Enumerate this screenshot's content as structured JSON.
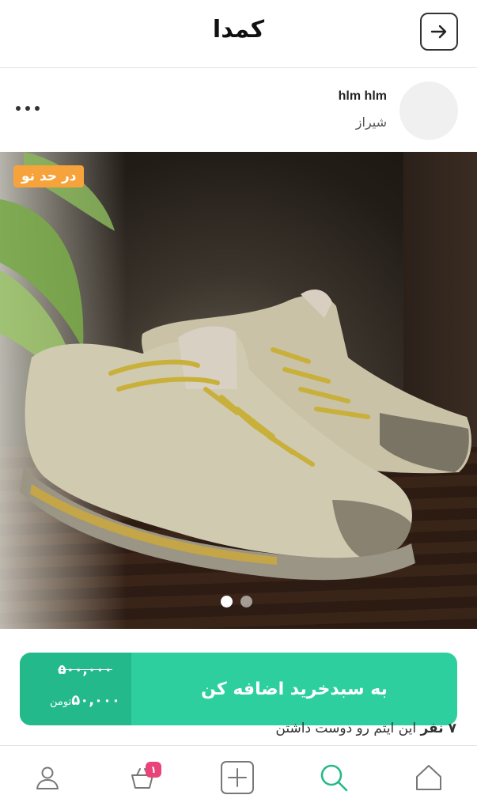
{
  "header": {
    "brand": "کمدا",
    "back_icon": "arrow-right-icon"
  },
  "seller": {
    "name": "hlm hlm",
    "city": "شیراز",
    "more_icon": "more-horizontal-icon"
  },
  "photo": {
    "condition_badge": "در حد نو",
    "carousel_count": 2,
    "carousel_active_index": 0
  },
  "cart": {
    "old_price": "۵۰۰,۰۰۰",
    "new_price": "۵۰,۰۰۰",
    "currency": "تومن",
    "add_label": "به سبدخرید اضافه کن"
  },
  "likes": {
    "count": "۷ نفر",
    "text": "این ایتم رو دوست داشتن"
  },
  "nav": {
    "items": [
      "profile-icon",
      "cart-icon",
      "add-icon",
      "search-icon",
      "home-icon"
    ],
    "cart_badge": "۱",
    "active": "search-icon"
  },
  "colors": {
    "accent": "#2ecf9e",
    "accent_dark": "#23b98a",
    "badge_orange": "#f7a33b",
    "badge_pink": "#e8447a"
  }
}
